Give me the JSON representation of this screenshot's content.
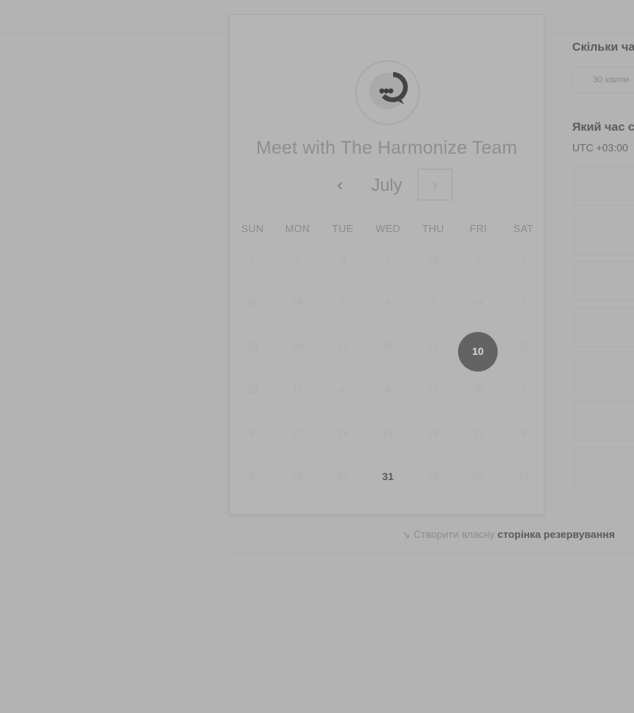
{
  "booking": {
    "title": "Meet with The Harmonize Team",
    "month": "July",
    "prev_icon": "‹",
    "next_icon": "›",
    "weekdays": [
      "SUN",
      "MON",
      "TUE",
      "WED",
      "THU",
      "FRI",
      "SAT"
    ],
    "weeks": [
      [
        "1",
        "2",
        "3",
        "7",
        "18",
        "2",
        "3"
      ],
      [
        "16",
        "24",
        "7",
        "8",
        "9",
        "24",
        "5"
      ],
      [
        "10",
        "20",
        "12",
        "19",
        "22",
        "10",
        "21"
      ],
      [
        "18",
        "13",
        "4",
        "4",
        "22",
        "20",
        "1"
      ],
      [
        "9",
        "22",
        "24",
        "21",
        "29",
        "13",
        "8"
      ],
      [
        "8",
        "26",
        "31",
        "31",
        "13",
        "28",
        "17"
      ]
    ],
    "selected_day": "10",
    "highlighted_day": "31"
  },
  "footer": {
    "icon": "↘",
    "text": "Створити власну",
    "link": "сторінка резервування"
  },
  "right_panel": {
    "duration_question": "Скільки ча",
    "duration_value": "30 хвили",
    "time_question": "Який час с",
    "timezone": "UTC +03:00"
  },
  "colors": {
    "overlay_background": "#b3b3b3",
    "selected_day_background": "#636363"
  }
}
